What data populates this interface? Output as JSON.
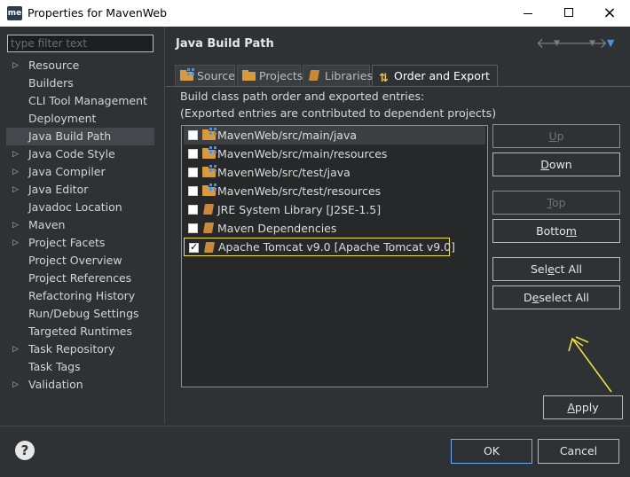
{
  "window": {
    "app_icon": "me",
    "title": "Properties for MavenWeb",
    "controls": {
      "minimize": "minimize-icon",
      "maximize": "maximize-icon",
      "close": "×"
    }
  },
  "filter": {
    "placeholder": "type filter text",
    "value": ""
  },
  "tree": [
    {
      "label": "Resource",
      "expandable": true
    },
    {
      "label": "Builders",
      "expandable": false
    },
    {
      "label": "CLI Tool Management",
      "expandable": false
    },
    {
      "label": "Deployment",
      "expandable": false
    },
    {
      "label": "Java Build Path",
      "expandable": false,
      "selected": true
    },
    {
      "label": "Java Code Style",
      "expandable": true
    },
    {
      "label": "Java Compiler",
      "expandable": true
    },
    {
      "label": "Java Editor",
      "expandable": true
    },
    {
      "label": "Javadoc Location",
      "expandable": false
    },
    {
      "label": "Maven",
      "expandable": true
    },
    {
      "label": "Project Facets",
      "expandable": true
    },
    {
      "label": "Project Overview",
      "expandable": false
    },
    {
      "label": "Project References",
      "expandable": false
    },
    {
      "label": "Refactoring History",
      "expandable": false
    },
    {
      "label": "Run/Debug Settings",
      "expandable": false
    },
    {
      "label": "Targeted Runtimes",
      "expandable": false
    },
    {
      "label": "Task Repository",
      "expandable": true
    },
    {
      "label": "Task Tags",
      "expandable": false
    },
    {
      "label": "Validation",
      "expandable": true
    }
  ],
  "page": {
    "title": "Java Build Path",
    "nav": {
      "back": "back-arrow-icon",
      "forward": "forward-arrow-icon",
      "menu": "view-menu-icon"
    }
  },
  "tabs": [
    {
      "label": "Source",
      "icon": "source-folder-icon"
    },
    {
      "label": "Projects",
      "icon": "projects-folder-icon"
    },
    {
      "label": "Libraries",
      "icon": "library-icon"
    },
    {
      "label": "Order and Export",
      "icon": "order-icon",
      "active": true
    }
  ],
  "description": {
    "line1": "Build class path order and exported entries:",
    "line2": "(Exported entries are contributed to dependent projects)"
  },
  "entries": [
    {
      "label": "MavenWeb/src/main/java",
      "checked": false,
      "icon": "source-folder-icon"
    },
    {
      "label": "MavenWeb/src/main/resources",
      "checked": false,
      "icon": "source-folder-icon"
    },
    {
      "label": "MavenWeb/src/test/java",
      "checked": false,
      "icon": "source-folder-icon"
    },
    {
      "label": "MavenWeb/src/test/resources",
      "checked": false,
      "icon": "source-folder-icon"
    },
    {
      "label": "JRE System Library [J2SE-1.5]",
      "checked": false,
      "icon": "library-icon"
    },
    {
      "label": "Maven Dependencies",
      "checked": false,
      "icon": "library-icon"
    },
    {
      "label": "Apache Tomcat v9.0 [Apache Tomcat v9.0]",
      "checked": true,
      "icon": "library-icon",
      "highlighted": true
    }
  ],
  "buttons": {
    "up": {
      "pre": "",
      "key": "U",
      "post": "p"
    },
    "down": {
      "pre": "",
      "key": "D",
      "post": "own"
    },
    "top": {
      "pre": "",
      "key": "T",
      "post": "op"
    },
    "bottom": {
      "pre": "Botto",
      "key": "m",
      "post": ""
    },
    "select_all": {
      "pre": "Sel",
      "key": "e",
      "post": "ct All"
    },
    "deselect_all": {
      "pre": "D",
      "key": "e",
      "post": "select All"
    },
    "apply": {
      "pre": "",
      "key": "A",
      "post": "pply"
    },
    "ok": "OK",
    "cancel": "Cancel"
  },
  "colors": {
    "background": "#2f3235",
    "highlight_box": "#f0e24a",
    "annotation_arrow": "#f0e24a",
    "ok_border": "#6fa8ff"
  },
  "help": "?"
}
